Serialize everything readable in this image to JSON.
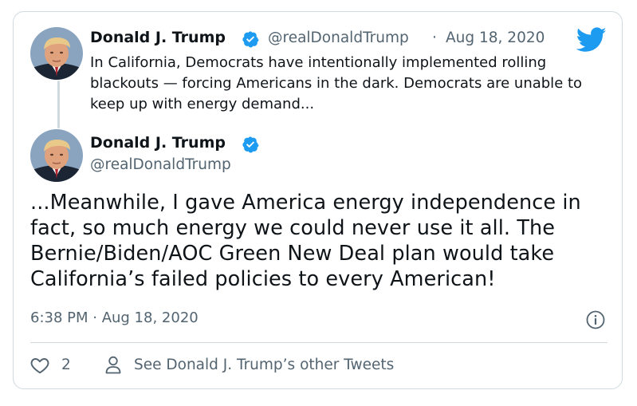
{
  "quoted_tweet": {
    "display_name": "Donald J. Trump",
    "handle": "@realDonaldTrump",
    "separator": "·",
    "date": "Aug 18, 2020",
    "text": "In California, Democrats have intentionally implemented rolling blackouts — forcing Americans in the dark. Democrats are unable to keep up with energy demand..."
  },
  "main_tweet": {
    "display_name": "Donald J. Trump",
    "handle": "@realDonaldTrump",
    "text": "...Meanwhile, I gave America energy independence in fact, so much energy we could never use it all. The Bernie/Biden/AOC Green New Deal plan would take California’s failed policies to every American!",
    "timestamp": "6:38 PM · Aug 18, 2020"
  },
  "actions": {
    "likes_count": "2",
    "see_other_label": "See Donald J. Trump’s other Tweets"
  },
  "colors": {
    "verified_blue": "#1d9bf0",
    "twitter_blue": "#1d9bf0",
    "muted_text": "#536471",
    "border": "#cfd9de"
  },
  "icons": [
    "twitter-bird-icon",
    "verified-badge-icon",
    "info-icon",
    "heart-icon",
    "person-icon"
  ]
}
